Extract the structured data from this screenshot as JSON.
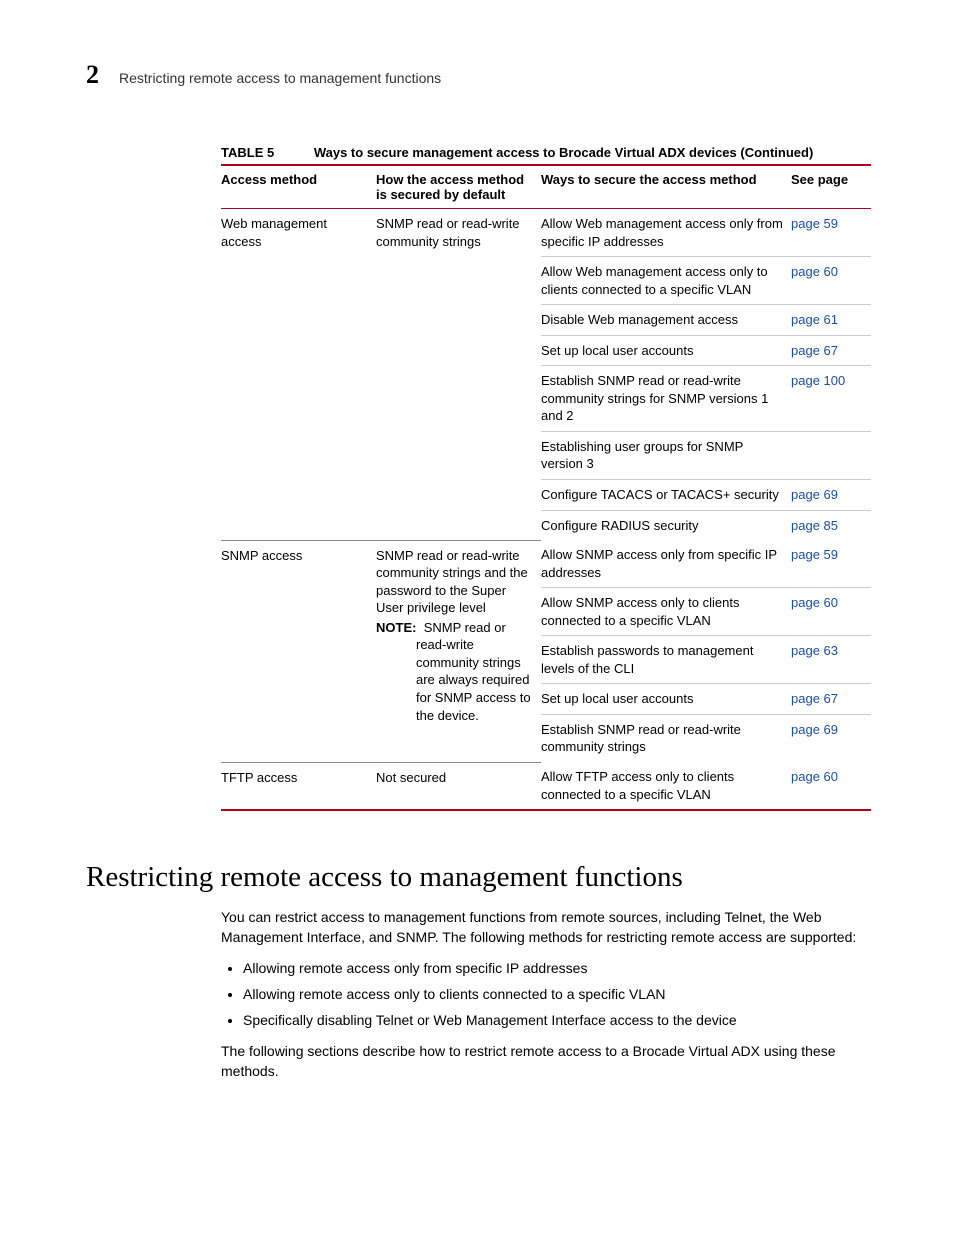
{
  "header": {
    "chapter_number": "2",
    "running_title": "Restricting remote access to management functions"
  },
  "table": {
    "label": "TABLE 5",
    "caption": "Ways to secure management access to Brocade Virtual ADX devices  (Continued)",
    "columns": {
      "c1": "Access method",
      "c2": "How the access method is secured by default",
      "c3": "Ways to secure the access method",
      "c4": "See page"
    },
    "groups": [
      {
        "access_method": "Web management access",
        "secured_by": "SNMP read or read-write community strings",
        "secured_note_label": "",
        "secured_note_body": "",
        "rows": [
          {
            "way": "Allow Web management access only from specific IP addresses",
            "page": "page 59"
          },
          {
            "way": "Allow Web management access only to clients connected to a specific VLAN",
            "page": "page 60"
          },
          {
            "way": "Disable Web management access",
            "page": "page 61"
          },
          {
            "way": "Set up local user accounts",
            "page": "page 67"
          },
          {
            "way": "Establish SNMP read or read-write community strings for SNMP versions 1 and 2",
            "page": "page 100"
          },
          {
            "way": "Establishing user groups for SNMP version 3",
            "page": ""
          },
          {
            "way": "Configure TACACS or TACACS+ security",
            "page": "page 69"
          },
          {
            "way": "Configure RADIUS security",
            "page": "page 85"
          }
        ]
      },
      {
        "access_method": "SNMP access",
        "secured_by": "SNMP read or read-write community strings and the password to the Super User privilege level",
        "secured_note_label": "NOTE:",
        "secured_note_body": "SNMP read or read-write community strings are always required for SNMP access to the device.",
        "rows": [
          {
            "way": "Allow SNMP access only from specific IP addresses",
            "page": "page 59"
          },
          {
            "way": "Allow SNMP access only to clients connected to a specific VLAN",
            "page": "page 60"
          },
          {
            "way": "Establish passwords to management levels of the CLI",
            "page": "page 63"
          },
          {
            "way": "Set up local user accounts",
            "page": "page 67"
          },
          {
            "way": "Establish SNMP read or read-write community strings",
            "page": "page 69"
          }
        ]
      },
      {
        "access_method": "TFTP access",
        "secured_by": "Not secured",
        "secured_note_label": "",
        "secured_note_body": "",
        "rows": [
          {
            "way": "Allow TFTP access only to clients connected to a specific VLAN",
            "page": "page 60"
          }
        ]
      }
    ]
  },
  "section": {
    "heading": "Restricting remote access to management functions",
    "intro": "You can restrict access to management functions from remote sources, including Telnet, the Web Management Interface, and SNMP. The following methods for restricting remote access are supported:",
    "bullets": [
      "Allowing remote access only from specific IP addresses",
      "Allowing remote access only to clients connected to a specific VLAN",
      "Specifically disabling Telnet or Web Management Interface access to the device"
    ],
    "outro": "The following sections describe how to restrict remote access to a Brocade Virtual ADX using these methods."
  }
}
